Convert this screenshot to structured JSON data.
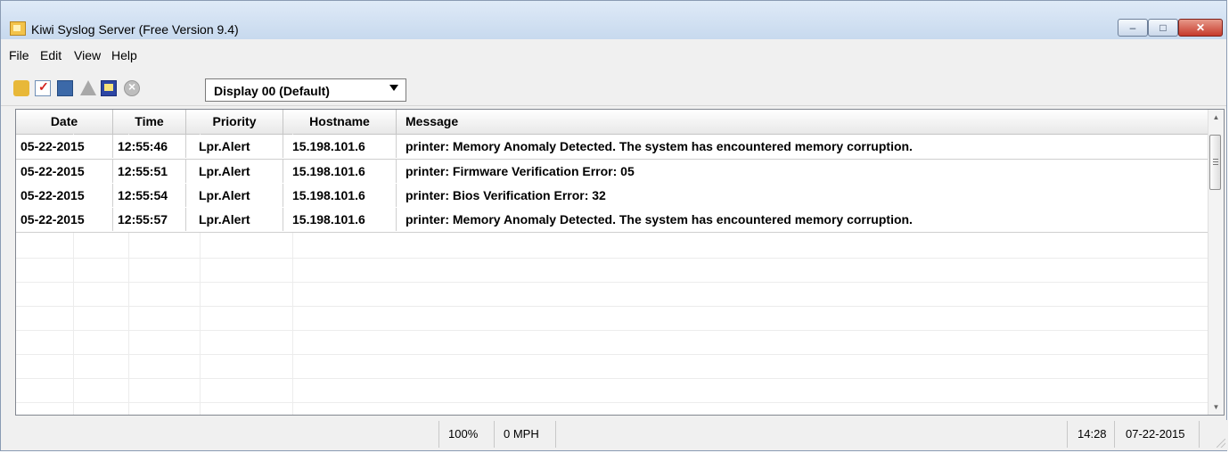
{
  "window": {
    "title": "Kiwi Syslog Server (Free Version 9.4)"
  },
  "window_controls": {
    "minimize": "–",
    "maximize": "□",
    "close": "✕"
  },
  "menu": {
    "items": [
      "File",
      "Edit",
      "View",
      "Help"
    ]
  },
  "toolbar": {
    "icons": [
      "lock-icon",
      "checklist-icon",
      "chart-icon",
      "warning-icon",
      "monitor-icon",
      "stop-icon"
    ],
    "display_select": "Display 00 (Default)"
  },
  "grid": {
    "columns": [
      "Date",
      "Time",
      "Priority",
      "Hostname",
      "Message"
    ],
    "rows": [
      {
        "date": "05-22-2015",
        "time": "12:55:46",
        "priority": "Lpr.Alert",
        "hostname": "15.198.101.6",
        "message": "printer: Memory Anomaly Detected. The system has encountered memory corruption."
      },
      {
        "date": "05-22-2015",
        "time": "12:55:51",
        "priority": "Lpr.Alert",
        "hostname": "15.198.101.6",
        "message": "printer: Firmware Verification Error: 05"
      },
      {
        "date": "05-22-2015",
        "time": "12:55:54",
        "priority": "Lpr.Alert",
        "hostname": "15.198.101.6",
        "message": "printer: Bios Verification Error: 32"
      },
      {
        "date": "05-22-2015",
        "time": "12:55:57",
        "priority": "Lpr.Alert",
        "hostname": "15.198.101.6",
        "message": "printer: Memory Anomaly Detected. The system has encountered memory corruption."
      }
    ]
  },
  "status": {
    "zoom": "100%",
    "rate": "0 MPH",
    "time": "14:28",
    "date": "07-22-2015"
  },
  "colors": {
    "titlebar": "#c7d9ee",
    "close_button": "#c63a2b",
    "grid_border": "#828790"
  }
}
